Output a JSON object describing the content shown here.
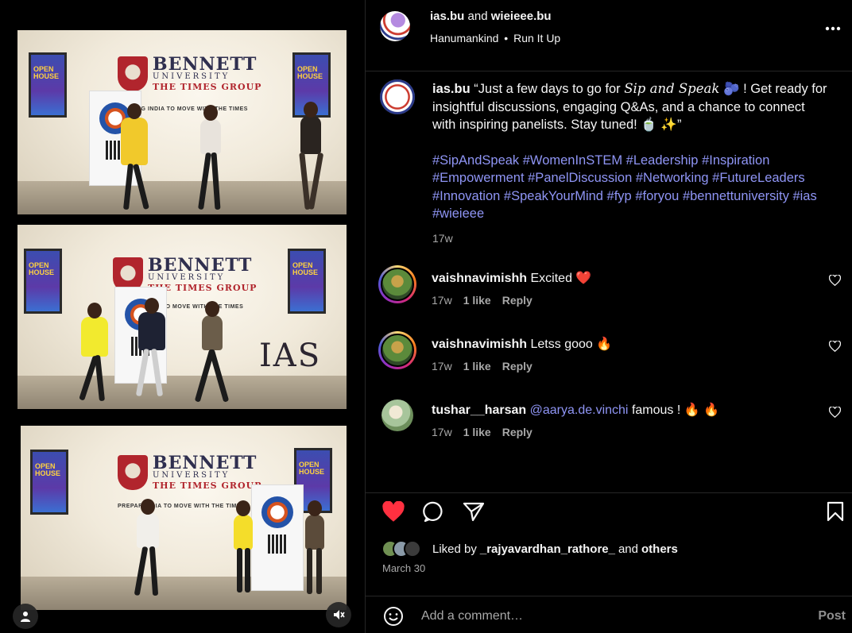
{
  "media": {
    "frame1": {
      "university_name": "BENNETT",
      "university_sub": "UNIVERSITY",
      "group": "THE TIMES GROUP",
      "tagline": "NG INDIA TO MOVE WITH THE TIMES",
      "poster_text": "OPEN HOUSE"
    },
    "frame2": {
      "university_name": "BENNETT",
      "university_sub": "UNIVERSITY",
      "group": "THE TIMES GROUP",
      "tagline": "TO MOVE WITH THE TIMES",
      "poster_text": "OPEN HOUSE",
      "ias_logo": "IAS"
    },
    "frame3": {
      "university_name": "BENNETT",
      "university_sub": "UNIVERSITY",
      "group": "THE TIMES GROUP",
      "tagline": "PREPARIN    DIA TO MOVE WITH THE TIMES",
      "poster_text": "OPEN HOUSE"
    },
    "icons": {
      "tag": "person-icon",
      "mute": "speaker-muted-icon"
    }
  },
  "header": {
    "author": "ias.bu",
    "and": "and",
    "collaborator": "wieieee.bu",
    "audio_artist": "Hanumankind",
    "audio_dot": "•",
    "audio_track": "Run It Up",
    "more_icon": "more-horizontal-icon"
  },
  "caption": {
    "username": "ias.bu",
    "text_start": "“Just a few days to go for",
    "script_text": "Sip and Speak",
    "emoji1": "🫐",
    "text_end": "! Get ready for insightful discussions, engaging Q&As, and a chance to connect with inspiring panelists. Stay tuned! 🍵 ✨”",
    "hashtags": "#SipAndSpeak #WomenInSTEM #Leadership #Inspiration #Empowerment #PanelDiscussion #Networking #FutureLeaders #Innovation #SpeakYourMind #fyp #foryou #bennettuniversity #ias #wieieee",
    "time": "17w"
  },
  "comments": [
    {
      "username": "vaishnavimishh",
      "text": "Excited",
      "emoji": "❤️",
      "time": "17w",
      "likes": "1 like",
      "reply": "Reply"
    },
    {
      "username": "vaishnavimishh",
      "text": "Letss gooo",
      "emoji": "🔥",
      "time": "17w",
      "likes": "1 like",
      "reply": "Reply"
    },
    {
      "username": "tushar__harsan",
      "mention": "@aarya.de.vinchi",
      "text": "famous !",
      "emoji": "🔥 🔥",
      "time": "17w",
      "likes": "1 like",
      "reply": "Reply"
    }
  ],
  "actions": {
    "like_icon": "heart-filled-icon",
    "comment_icon": "comment-icon",
    "share_icon": "share-icon",
    "save_icon": "bookmark-icon",
    "liked_prefix": "Liked by",
    "liked_user": "_rajyavardhan_rathore_",
    "liked_and": "and",
    "liked_others": "others",
    "date": "March 30"
  },
  "add_comment": {
    "emoji_icon": "smiley-icon",
    "placeholder": "Add a comment…",
    "post_label": "Post"
  },
  "colors": {
    "background": "#000000",
    "link": "#8f95f5",
    "like_red": "#ff3040",
    "muted": "#a8a8a8",
    "divider": "#262626"
  }
}
